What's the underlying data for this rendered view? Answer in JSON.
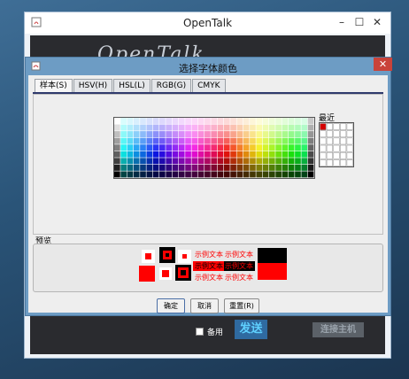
{
  "back_window": {
    "title": "OpenTalk",
    "backup_label": "备用",
    "send_label": "发送",
    "connect_label": "连接主机"
  },
  "dialog": {
    "title": "选择字体颜色",
    "tabs": [
      {
        "label": "样本(S)",
        "active": true
      },
      {
        "label": "HSV(H)",
        "active": false
      },
      {
        "label": "HSL(L)",
        "active": false
      },
      {
        "label": "RGB(G)",
        "active": false
      },
      {
        "label": "CMYK",
        "active": false
      }
    ],
    "recent_label": "最近",
    "preview_label": "预览",
    "sample_text": "示例文本",
    "buttons": {
      "ok": "确定",
      "cancel": "取消",
      "reset": "重置(R)"
    }
  },
  "colors": {
    "preview": "#ff0000",
    "recent_first": "#d40000",
    "dialog_frame": "#6d9cc4",
    "close": "#c9433a"
  }
}
